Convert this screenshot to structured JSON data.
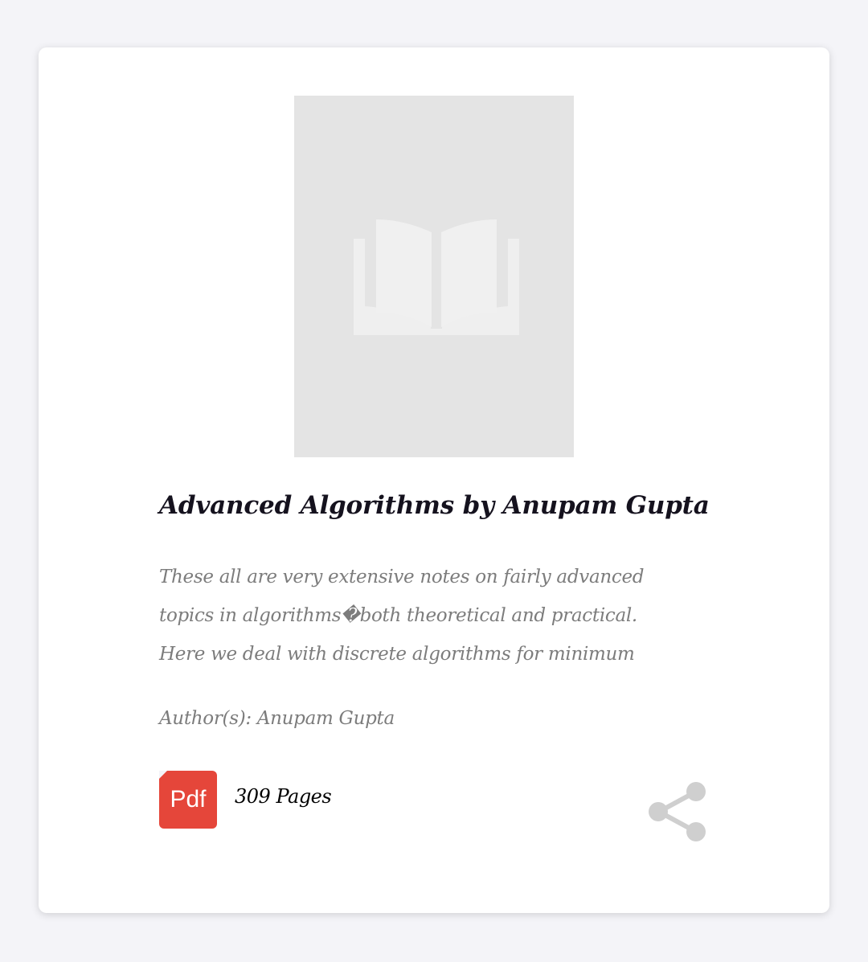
{
  "book": {
    "title": "Advanced Algorithms by Anupam Gupta",
    "description_lines": [
      "These all are very extensive notes on fairly advanced",
      "topics in algorithms�both theoretical and practical.",
      "Here we deal with discrete algorithms for minimum"
    ],
    "author": "Author(s): Anupam Gupta",
    "format_label": "Pdf",
    "pages": "309 Pages"
  },
  "icons": {
    "cover_placeholder": "open-book-icon",
    "share": "share-icon",
    "format": "pdf-icon"
  },
  "colors": {
    "page_background": "#f4f4f8",
    "card_background": "#ffffff",
    "cover_placeholder": "#e4e4e4",
    "title": "#15121e",
    "muted_text": "#7c7c7c",
    "pdf_badge": "#e5463a",
    "share_icon": "#cfcfcf"
  }
}
